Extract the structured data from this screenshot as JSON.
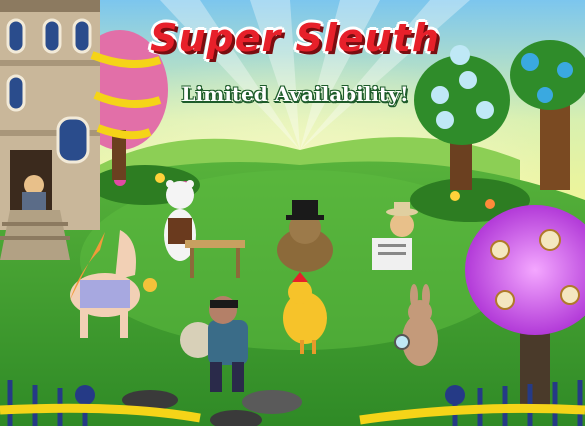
{
  "banner": {
    "title": "Super Sleuth",
    "subtitle": "Limited Availability!"
  },
  "colors": {
    "sky": "#9fd7f0",
    "grass": "#3f9a2f",
    "title_red": "#e7202a",
    "tape_yellow": "#f5d418",
    "fence": "#253a86"
  },
  "scene_items": [
    "mansion-with-crime-tape",
    "farmer-at-window",
    "polar-bear-detective",
    "pony-in-dress-with-lantern",
    "bandit-with-sack",
    "dog-detective-with-pipe",
    "chicken-detective",
    "newspaper-reader",
    "rabbit-with-magnifier",
    "clock-tree",
    "jar-tree",
    "blue-bird-tree",
    "manhole-covers",
    "police-tape-fence"
  ]
}
